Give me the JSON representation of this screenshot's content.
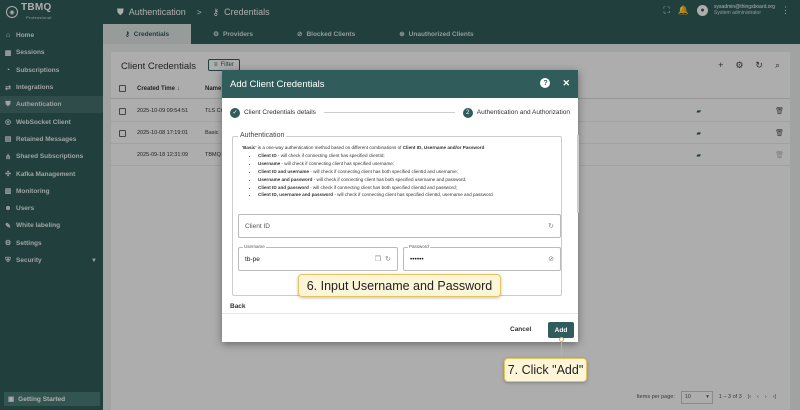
{
  "app": {
    "logo_text": "TBMQ",
    "logo_sub": "Professional"
  },
  "sidebar": {
    "items": [
      {
        "label": "Home",
        "icon": "home-icon"
      },
      {
        "label": "Sessions",
        "icon": "sessions-icon"
      },
      {
        "label": "Subscriptions",
        "icon": "subscriptions-icon"
      },
      {
        "label": "Integrations",
        "icon": "integrations-icon"
      },
      {
        "label": "Authentication",
        "icon": "shield-icon"
      },
      {
        "label": "WebSocket Client",
        "icon": "websocket-icon"
      },
      {
        "label": "Retained Messages",
        "icon": "retained-icon"
      },
      {
        "label": "Shared Subscriptions",
        "icon": "shared-icon"
      },
      {
        "label": "Kafka Management",
        "icon": "kafka-icon"
      },
      {
        "label": "Monitoring",
        "icon": "monitoring-icon"
      },
      {
        "label": "Users",
        "icon": "users-icon"
      },
      {
        "label": "White labeling",
        "icon": "palette-icon"
      },
      {
        "label": "Settings",
        "icon": "gear-icon"
      },
      {
        "label": "Security",
        "icon": "lock-icon"
      }
    ],
    "getting_started": "Getting Started"
  },
  "topbar": {
    "section": "Authentication",
    "page": "Credentials",
    "user_email": "sysadmin@thingsboard.org",
    "user_role": "System administrator"
  },
  "tabs": [
    {
      "label": "Credentials"
    },
    {
      "label": "Providers"
    },
    {
      "label": "Blocked Clients"
    },
    {
      "label": "Unauthorized Clients"
    }
  ],
  "table": {
    "title": "Client Credentials",
    "filter_label": "Filter",
    "headers": {
      "created": "Created Time",
      "name": "Name"
    },
    "rows": [
      {
        "created": "2025-10-09 09:54:51",
        "name": "TLS Cr"
      },
      {
        "created": "2025-10-08 17:19:01",
        "name": "Basic"
      },
      {
        "created": "2025-09-18 12:31:09",
        "name": "TBMQ"
      }
    ],
    "items_per_page_label": "Items per page:",
    "items_per_page": "10",
    "range": "1 – 3 of 3"
  },
  "dialog": {
    "title": "Add Client Credentials",
    "step1_label": "Client Credentials details",
    "step2_num": "2",
    "step2_label": "Authentication and Authorization",
    "section_title": "Authentication",
    "desc_intro_bold": "'Basic'",
    "desc_intro": " is a one-way authentication method based on different combinations of ",
    "desc_intro_bold2": "Client ID, Username and/or Password",
    "desc_items": [
      {
        "b": "Client ID",
        "t": " - will check if connecting client has specified clientId;"
      },
      {
        "b": "Username",
        "t": " - will check if connecting client has specified username;"
      },
      {
        "b": "Client ID and username",
        "t": " - will check if connecting client has both specified clientId and username;"
      },
      {
        "b": "Username and password",
        "t": " - will check if connecting client has both specified username and password;"
      },
      {
        "b": "Client ID and password",
        "t": " - will check if connecting client has both specified clientId and password;"
      },
      {
        "b": "Client ID, username and password",
        "t": " - will check if connecting client has specified clientId, username and password"
      }
    ],
    "client_id_placeholder": "Client ID",
    "username_label": "Username",
    "username_value": "tb-pe",
    "password_label": "Password",
    "password_value": "••••••",
    "back_label": "Back",
    "cancel_label": "Cancel",
    "add_label": "Add"
  },
  "callouts": {
    "step6": "6. Input Username and Password",
    "step7": "7. Click \"Add\""
  },
  "colors": {
    "brand": "#305d5b",
    "callout_bg": "#fdf5d8",
    "callout_border": "#e6c55f"
  }
}
